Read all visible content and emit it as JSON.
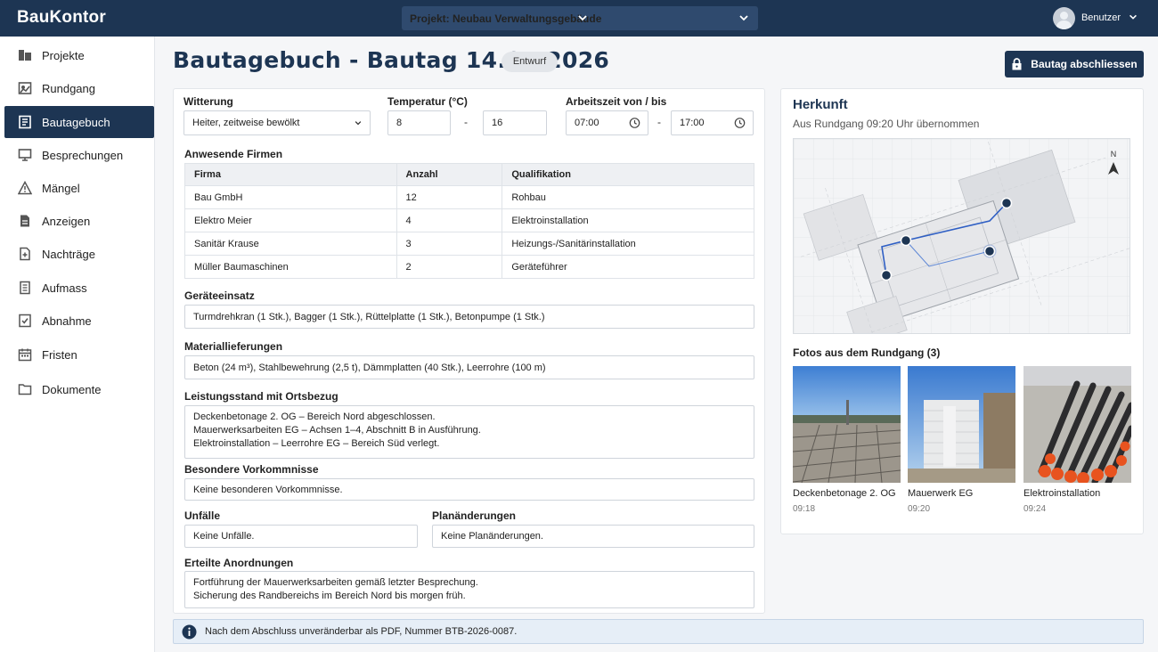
{
  "app": {
    "brand": "BauKontor"
  },
  "header": {
    "project_label": "Projekt: Neubau Verwaltungsgebäude",
    "user_name": "Benutzer"
  },
  "sidebar": {
    "items": [
      {
        "label": "Projekte",
        "icon": "folders-icon"
      },
      {
        "label": "Rundgang",
        "icon": "walk-icon"
      },
      {
        "label": "Bautagebuch",
        "icon": "logbook-icon",
        "active": true
      },
      {
        "label": "Besprechungen",
        "icon": "monitor-icon"
      },
      {
        "label": "Mängel",
        "icon": "warning-icon"
      },
      {
        "label": "Anzeigen",
        "icon": "document-icon"
      },
      {
        "label": "Nachträge",
        "icon": "addendum-icon"
      },
      {
        "label": "Aufmass",
        "icon": "clipboard-icon"
      },
      {
        "label": "Abnahme",
        "icon": "check-document-icon"
      },
      {
        "label": "Fristen",
        "icon": "calendar-icon"
      },
      {
        "label": "Dokumente",
        "icon": "folder-icon"
      }
    ]
  },
  "page": {
    "title": "Bautagebuch - Bautag 14.05.2026",
    "status": "Entwurf",
    "close_button": "Bautag abschliessen"
  },
  "form": {
    "weather_label": "Witterung",
    "weather_value": "Heiter, zeitweise bewölkt",
    "temp_label": "Temperatur (°C)",
    "temp_min": "8",
    "temp_max": "16",
    "worktime_label": "Arbeitszeit von / bis",
    "work_from": "07:00",
    "work_to": "17:00",
    "dash": "-",
    "firms_label": "Anwesende Firmen",
    "firms_headers": [
      "Firma",
      "Anzahl",
      "Qualifikation"
    ],
    "firms_rows": [
      [
        "Bau GmbH",
        "12",
        "Rohbau"
      ],
      [
        "Elektro Meier",
        "4",
        "Elektroinstallation"
      ],
      [
        "Sanitär Krause",
        "3",
        "Heizungs-/Sanitärinstallation"
      ],
      [
        "Müller Baumaschinen",
        "2",
        "Geräteführer"
      ]
    ],
    "equipment_label": "Geräteeinsatz",
    "equipment_value": "Turmdrehkran (1 Stk.), Bagger (1 Stk.), Rüttelplatte (1 Stk.), Betonpumpe (1 Stk.)",
    "materials_label": "Materiallieferungen",
    "materials_value": "Beton (24 m³), Stahlbewehrung (2,5 t), Dämmplatten (40 Stk.), Leerrohre (100 m)",
    "progress_label": "Leistungsstand mit Ortsbezug",
    "progress_lines": [
      "Deckenbetonage 2. OG – Bereich Nord abgeschlossen.",
      "Mauerwerksarbeiten EG – Achsen 1–4, Abschnitt B in Ausführung.",
      "Elektroinstallation – Leerrohre EG – Bereich Süd verlegt."
    ],
    "incidents_label": "Besondere Vorkommnisse",
    "incidents_value": "Keine besonderen Vorkommnisse.",
    "accidents_label": "Unfälle",
    "accidents_value": "Keine Unfälle.",
    "planchanges_label": "Planänderungen",
    "planchanges_value": "Keine Planänderungen.",
    "orders_label": "Erteilte Anordnungen",
    "orders_lines": [
      "Fortführung der Mauerwerksarbeiten gemäß letzter Besprechung.",
      "Sicherung des Randbereichs im Bereich Nord bis morgen früh."
    ]
  },
  "side": {
    "title": "Herkunft",
    "subtitle": "Aus Rundgang 09:20 Uhr übernommen",
    "north": "N",
    "photos_title": "Fotos aus dem Rundgang (3)",
    "photos": [
      {
        "caption": "Deckenbetonage 2. OG",
        "time": "09:18"
      },
      {
        "caption": "Mauerwerk EG",
        "time": "09:20"
      },
      {
        "caption": "Elektroinstallation",
        "time": "09:24"
      }
    ]
  },
  "info": {
    "text": "Nach dem Abschluss unveränderbar als PDF, Nummer BTB-2026-0087."
  },
  "colors": {
    "primary": "#1d3553",
    "route": "#2f5fc4",
    "info_bg": "#e6eef7"
  }
}
